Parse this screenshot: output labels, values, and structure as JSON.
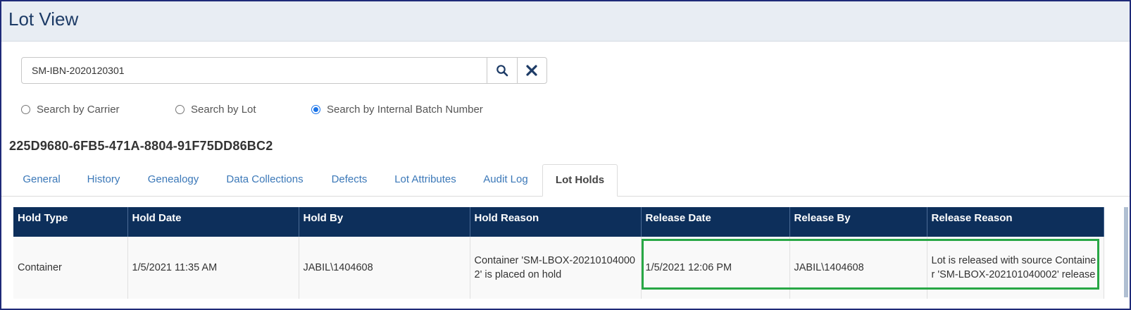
{
  "page": {
    "title": "Lot View"
  },
  "search": {
    "value": "SM-IBN-2020120301"
  },
  "colors": {
    "header_bg": "#e8edf3",
    "table_header": "#0d2f5b",
    "link": "#3b78b8",
    "highlight": "#28a745",
    "title": "#1d3b66"
  },
  "search_options": [
    {
      "label": "Search by Carrier",
      "checked": false
    },
    {
      "label": "Search by Lot",
      "checked": false
    },
    {
      "label": "Search by Internal Batch Number",
      "checked": true
    }
  ],
  "lot": {
    "id": "225D9680-6FB5-471A-8804-91F75DD86BC2"
  },
  "tabs": [
    {
      "label": "General"
    },
    {
      "label": "History"
    },
    {
      "label": "Genealogy"
    },
    {
      "label": "Data Collections"
    },
    {
      "label": "Defects"
    },
    {
      "label": "Lot Attributes"
    },
    {
      "label": "Audit Log"
    },
    {
      "label": "Lot Holds",
      "active": true
    }
  ],
  "holds_table": {
    "headers": [
      "Hold Type",
      "Hold Date",
      "Hold By",
      "Hold Reason",
      "Release Date",
      "Release By",
      "Release Reason"
    ],
    "rows": [
      [
        "Container",
        "1/5/2021 11:35 AM",
        "JABIL\\1404608",
        "Container 'SM-LBOX-202101040002' is placed on hold",
        "1/5/2021 12:06 PM",
        "JABIL\\1404608",
        "Lot is released with source Container 'SM-LBOX-202101040002' release"
      ]
    ]
  },
  "icons": {
    "search": "search-icon",
    "clear": "close-icon"
  }
}
